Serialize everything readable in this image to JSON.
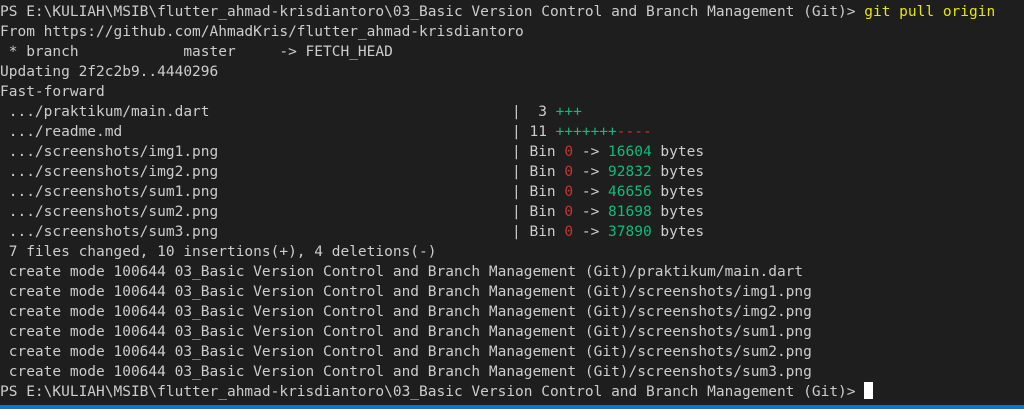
{
  "prompt1": "PS E:\\KULIAH\\MSIB\\flutter_ahmad-krisdiantoro\\03_Basic Version Control and Branch Management (Git)> ",
  "command": "git pull origin",
  "from_line": "From https://github.com/AhmadKris/flutter_ahmad-krisdiantoro",
  "branch_line": " * branch            master     -> FETCH_HEAD",
  "updating_line": "Updating 2f2c2b9..4440296",
  "ff_line": "Fast-forward",
  "diffstat": [
    {
      "file": " .../praktikum/main.dart",
      "pipe": "|",
      "count": "  3 ",
      "plus": "+++",
      "minus": "",
      "kind": "text"
    },
    {
      "file": " .../readme.md",
      "pipe": "|",
      "count": " 11 ",
      "plus": "+++++++",
      "minus": "----",
      "kind": "text"
    },
    {
      "file": " .../screenshots/img1.png",
      "pipe": "|",
      "bin": " Bin ",
      "from": "0",
      "arrow": " -> ",
      "to": "16604",
      "unit": " bytes",
      "kind": "bin"
    },
    {
      "file": " .../screenshots/img2.png",
      "pipe": "|",
      "bin": " Bin ",
      "from": "0",
      "arrow": " -> ",
      "to": "92832",
      "unit": " bytes",
      "kind": "bin"
    },
    {
      "file": " .../screenshots/sum1.png",
      "pipe": "|",
      "bin": " Bin ",
      "from": "0",
      "arrow": " -> ",
      "to": "46656",
      "unit": " bytes",
      "kind": "bin"
    },
    {
      "file": " .../screenshots/sum2.png",
      "pipe": "|",
      "bin": " Bin ",
      "from": "0",
      "arrow": " -> ",
      "to": "81698",
      "unit": " bytes",
      "kind": "bin"
    },
    {
      "file": " .../screenshots/sum3.png",
      "pipe": "|",
      "bin": " Bin ",
      "from": "0",
      "arrow": " -> ",
      "to": "37890",
      "unit": " bytes",
      "kind": "bin"
    }
  ],
  "summary_line": " 7 files changed, 10 insertions(+), 4 deletions(-)",
  "create_lines": [
    " create mode 100644 03_Basic Version Control and Branch Management (Git)/praktikum/main.dart",
    " create mode 100644 03_Basic Version Control and Branch Management (Git)/screenshots/img1.png",
    " create mode 100644 03_Basic Version Control and Branch Management (Git)/screenshots/img2.png",
    " create mode 100644 03_Basic Version Control and Branch Management (Git)/screenshots/sum1.png",
    " create mode 100644 03_Basic Version Control and Branch Management (Git)/screenshots/sum2.png",
    " create mode 100644 03_Basic Version Control and Branch Management (Git)/screenshots/sum3.png"
  ],
  "prompt2": "PS E:\\KULIAH\\MSIB\\flutter_ahmad-krisdiantoro\\03_Basic Version Control and Branch Management (Git)> ",
  "colors": {
    "background": "#1e1e1e",
    "foreground": "#cccccc",
    "command": "#e5e510",
    "insertions": "#0dbc79",
    "deletions": "#cd3131",
    "status_bar": "#007acc"
  }
}
